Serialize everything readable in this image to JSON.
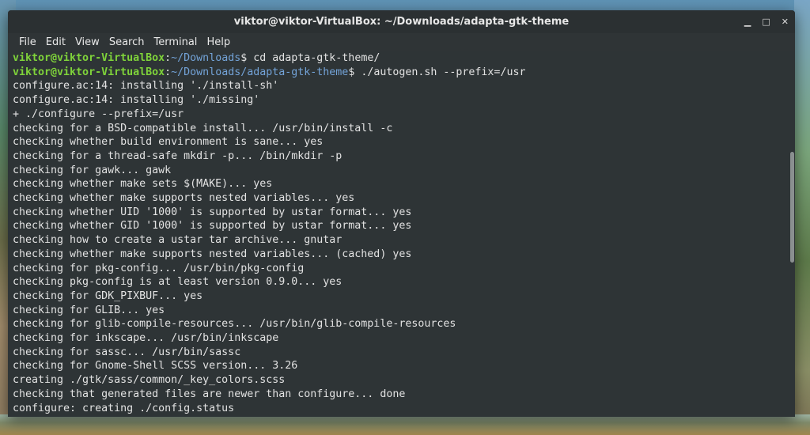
{
  "window": {
    "title": "viktor@viktor-VirtualBox: ~/Downloads/adapta-gtk-theme",
    "controls": {
      "minimize": "▁",
      "maximize": "□",
      "close": "✕"
    }
  },
  "menu": [
    "File",
    "Edit",
    "View",
    "Search",
    "Terminal",
    "Help"
  ],
  "prompts": [
    {
      "user": "viktor@viktor-VirtualBox",
      "sep": ":",
      "path": "~/Downloads",
      "cmd": "$ cd adapta-gtk-theme/"
    },
    {
      "user": "viktor@viktor-VirtualBox",
      "sep": ":",
      "path": "~/Downloads/adapta-gtk-theme",
      "cmd": "$ ./autogen.sh --prefix=/usr"
    }
  ],
  "output": [
    "configure.ac:14: installing './install-sh'",
    "configure.ac:14: installing './missing'",
    "+ ./configure --prefix=/usr",
    "checking for a BSD-compatible install... /usr/bin/install -c",
    "checking whether build environment is sane... yes",
    "checking for a thread-safe mkdir -p... /bin/mkdir -p",
    "checking for gawk... gawk",
    "checking whether make sets $(MAKE)... yes",
    "checking whether make supports nested variables... yes",
    "checking whether UID '1000' is supported by ustar format... yes",
    "checking whether GID '1000' is supported by ustar format... yes",
    "checking how to create a ustar tar archive... gnutar",
    "checking whether make supports nested variables... (cached) yes",
    "checking for pkg-config... /usr/bin/pkg-config",
    "checking pkg-config is at least version 0.9.0... yes",
    "checking for GDK_PIXBUF... yes",
    "checking for GLIB... yes",
    "checking for glib-compile-resources... /usr/bin/glib-compile-resources",
    "checking for inkscape... /usr/bin/inkscape",
    "checking for sassc... /usr/bin/sassc",
    "checking for Gnome-Shell SCSS version... 3.26",
    "creating ./gtk/sass/common/_key_colors.scss",
    "checking that generated files are newer than configure... done",
    "configure: creating ./config.status"
  ]
}
